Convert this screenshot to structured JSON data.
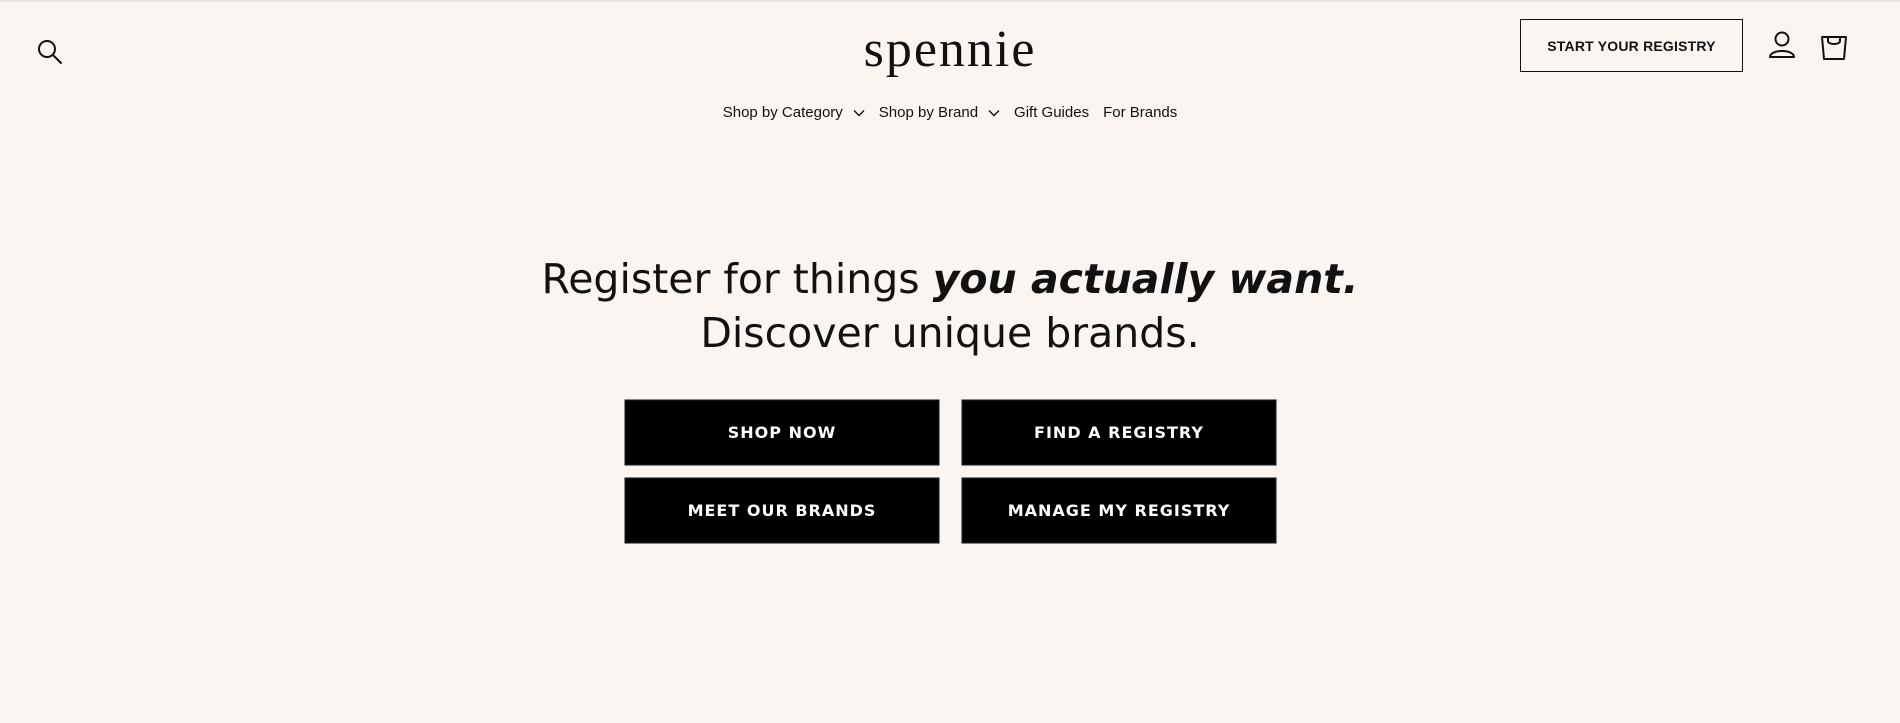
{
  "header": {
    "logo": "spennie",
    "registry_cta": "START YOUR REGISTRY",
    "icons": {
      "search": "search-icon",
      "account": "user-icon",
      "cart": "cart-icon"
    }
  },
  "nav": {
    "items": [
      {
        "label": "Shop by Category",
        "has_dropdown": true
      },
      {
        "label": "Shop by Brand",
        "has_dropdown": true
      },
      {
        "label": "Gift Guides",
        "has_dropdown": false
      },
      {
        "label": "For Brands",
        "has_dropdown": false
      }
    ]
  },
  "hero": {
    "line1_plain": "Register for things ",
    "line1_emphasis": "you actually want.",
    "line2": "Discover unique brands."
  },
  "buttons": {
    "shop_now": "SHOP NOW",
    "find_registry": "FIND A REGISTRY",
    "meet_brands": "MEET OUR BRANDS",
    "manage_registry": "MANAGE MY REGISTRY"
  },
  "colors": {
    "background": "#faf5f1",
    "button_bg": "#000000",
    "button_text": "#ffffff",
    "text": "#111111"
  }
}
